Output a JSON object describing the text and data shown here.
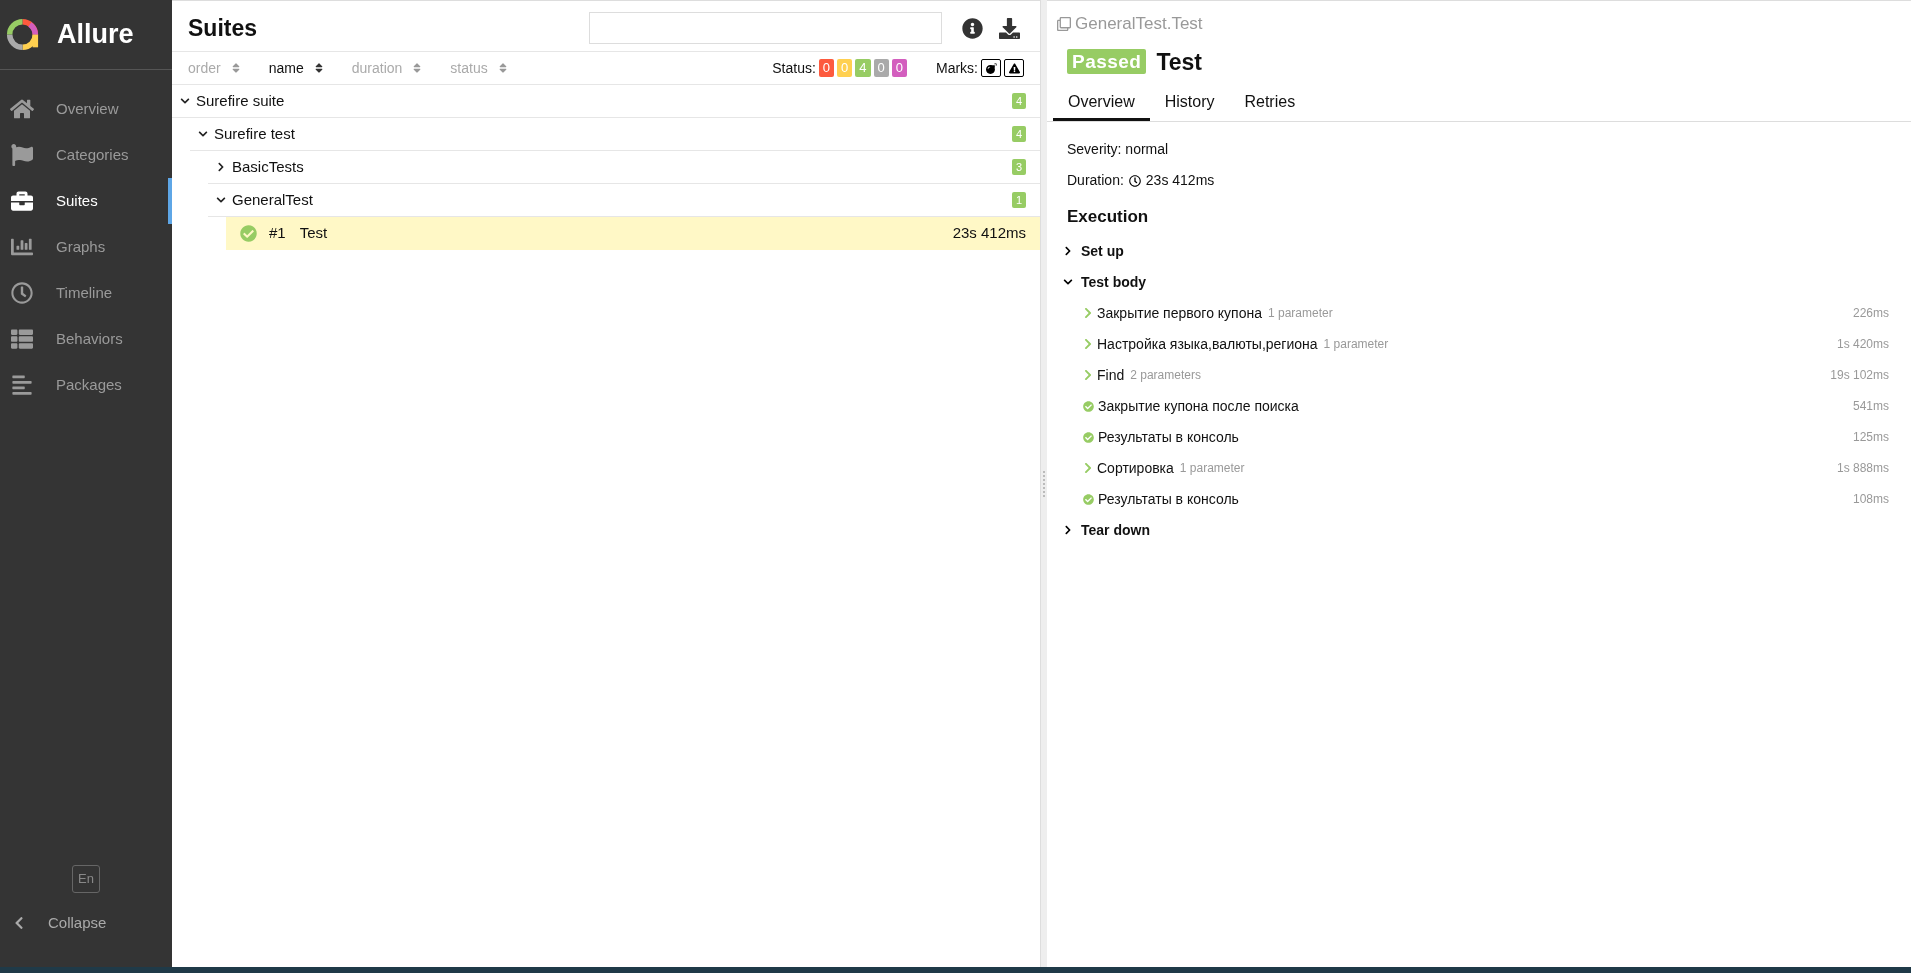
{
  "sidebar": {
    "logo": "Allure",
    "items": [
      {
        "label": "Overview",
        "selected": false
      },
      {
        "label": "Categories",
        "selected": false
      },
      {
        "label": "Suites",
        "selected": true
      },
      {
        "label": "Graphs",
        "selected": false
      },
      {
        "label": "Timeline",
        "selected": false
      },
      {
        "label": "Behaviors",
        "selected": false
      },
      {
        "label": "Packages",
        "selected": false
      }
    ],
    "language": "En",
    "collapse": "Collapse"
  },
  "suites": {
    "title": "Suites",
    "sort": [
      {
        "label": "order",
        "selected": false
      },
      {
        "label": "name",
        "selected": true
      },
      {
        "label": "duration",
        "selected": false
      },
      {
        "label": "status",
        "selected": false
      }
    ],
    "status_label": "Status:",
    "status_counts": [
      {
        "value": "0",
        "color": "#fd5a3e"
      },
      {
        "value": "0",
        "color": "#ffd050"
      },
      {
        "value": "4",
        "color": "#97cc64"
      },
      {
        "value": "0",
        "color": "#aaaaaa"
      },
      {
        "value": "0",
        "color": "#d35ebe"
      }
    ],
    "marks_label": "Marks:",
    "tree": [
      {
        "name": "Surefire suite",
        "count": "4",
        "expanded": true,
        "children": [
          {
            "name": "Surefire test",
            "count": "4",
            "expanded": true,
            "children": [
              {
                "name": "BasicTests",
                "count": "3",
                "expanded": false
              },
              {
                "name": "GeneralTest",
                "count": "1",
                "expanded": true,
                "tests": [
                  {
                    "number": "#1",
                    "name": "Test",
                    "duration": "23s 412ms",
                    "selected": true
                  }
                ]
              }
            ]
          }
        ]
      }
    ]
  },
  "test": {
    "path": "GeneralTest.Test",
    "status": "Passed",
    "title": "Test",
    "tabs": [
      {
        "label": "Overview",
        "selected": true
      },
      {
        "label": "History",
        "selected": false
      },
      {
        "label": "Retries",
        "selected": false
      }
    ],
    "severity": "Severity: normal",
    "duration_label": "Duration:",
    "duration": "23s 412ms",
    "execution_title": "Execution",
    "sections": [
      {
        "title": "Set up",
        "expanded": false
      },
      {
        "title": "Test body",
        "expanded": true,
        "steps": [
          {
            "kind": "expandable",
            "name": "Закрытие первого купона",
            "parameters": "1 parameter",
            "duration": "226ms"
          },
          {
            "kind": "expandable",
            "name": "Настройка языка,валюты,региона",
            "parameters": "1 parameter",
            "duration": "1s 420ms"
          },
          {
            "kind": "expandable",
            "name": "Find",
            "parameters": "2 parameters",
            "duration": "19s 102ms"
          },
          {
            "kind": "passed",
            "name": "Закрытие купона после поиска",
            "duration": "541ms"
          },
          {
            "kind": "passed",
            "name": "Результаты в консоль",
            "duration": "125ms"
          },
          {
            "kind": "expandable",
            "name": "Сортировка",
            "parameters": "1 parameter",
            "duration": "1s 888ms"
          },
          {
            "kind": "passed",
            "name": "Результаты в консоль",
            "duration": "108ms"
          }
        ]
      },
      {
        "title": "Tear down",
        "expanded": false
      }
    ]
  }
}
